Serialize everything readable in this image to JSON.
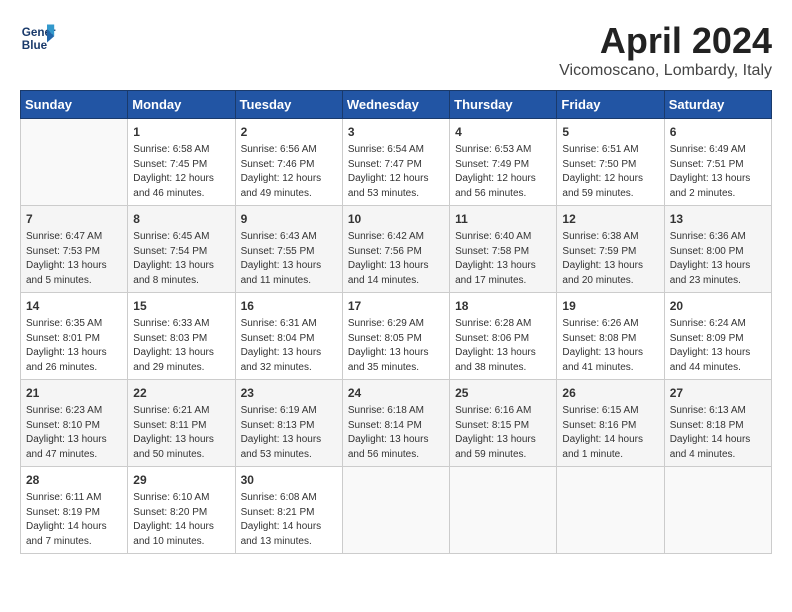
{
  "header": {
    "logo_line1": "General",
    "logo_line2": "Blue",
    "month_title": "April 2024",
    "location": "Vicomoscano, Lombardy, Italy"
  },
  "calendar": {
    "days_of_week": [
      "Sunday",
      "Monday",
      "Tuesday",
      "Wednesday",
      "Thursday",
      "Friday",
      "Saturday"
    ],
    "weeks": [
      [
        {
          "day": "",
          "info": ""
        },
        {
          "day": "1",
          "info": "Sunrise: 6:58 AM\nSunset: 7:45 PM\nDaylight: 12 hours\nand 46 minutes."
        },
        {
          "day": "2",
          "info": "Sunrise: 6:56 AM\nSunset: 7:46 PM\nDaylight: 12 hours\nand 49 minutes."
        },
        {
          "day": "3",
          "info": "Sunrise: 6:54 AM\nSunset: 7:47 PM\nDaylight: 12 hours\nand 53 minutes."
        },
        {
          "day": "4",
          "info": "Sunrise: 6:53 AM\nSunset: 7:49 PM\nDaylight: 12 hours\nand 56 minutes."
        },
        {
          "day": "5",
          "info": "Sunrise: 6:51 AM\nSunset: 7:50 PM\nDaylight: 12 hours\nand 59 minutes."
        },
        {
          "day": "6",
          "info": "Sunrise: 6:49 AM\nSunset: 7:51 PM\nDaylight: 13 hours\nand 2 minutes."
        }
      ],
      [
        {
          "day": "7",
          "info": "Sunrise: 6:47 AM\nSunset: 7:53 PM\nDaylight: 13 hours\nand 5 minutes."
        },
        {
          "day": "8",
          "info": "Sunrise: 6:45 AM\nSunset: 7:54 PM\nDaylight: 13 hours\nand 8 minutes."
        },
        {
          "day": "9",
          "info": "Sunrise: 6:43 AM\nSunset: 7:55 PM\nDaylight: 13 hours\nand 11 minutes."
        },
        {
          "day": "10",
          "info": "Sunrise: 6:42 AM\nSunset: 7:56 PM\nDaylight: 13 hours\nand 14 minutes."
        },
        {
          "day": "11",
          "info": "Sunrise: 6:40 AM\nSunset: 7:58 PM\nDaylight: 13 hours\nand 17 minutes."
        },
        {
          "day": "12",
          "info": "Sunrise: 6:38 AM\nSunset: 7:59 PM\nDaylight: 13 hours\nand 20 minutes."
        },
        {
          "day": "13",
          "info": "Sunrise: 6:36 AM\nSunset: 8:00 PM\nDaylight: 13 hours\nand 23 minutes."
        }
      ],
      [
        {
          "day": "14",
          "info": "Sunrise: 6:35 AM\nSunset: 8:01 PM\nDaylight: 13 hours\nand 26 minutes."
        },
        {
          "day": "15",
          "info": "Sunrise: 6:33 AM\nSunset: 8:03 PM\nDaylight: 13 hours\nand 29 minutes."
        },
        {
          "day": "16",
          "info": "Sunrise: 6:31 AM\nSunset: 8:04 PM\nDaylight: 13 hours\nand 32 minutes."
        },
        {
          "day": "17",
          "info": "Sunrise: 6:29 AM\nSunset: 8:05 PM\nDaylight: 13 hours\nand 35 minutes."
        },
        {
          "day": "18",
          "info": "Sunrise: 6:28 AM\nSunset: 8:06 PM\nDaylight: 13 hours\nand 38 minutes."
        },
        {
          "day": "19",
          "info": "Sunrise: 6:26 AM\nSunset: 8:08 PM\nDaylight: 13 hours\nand 41 minutes."
        },
        {
          "day": "20",
          "info": "Sunrise: 6:24 AM\nSunset: 8:09 PM\nDaylight: 13 hours\nand 44 minutes."
        }
      ],
      [
        {
          "day": "21",
          "info": "Sunrise: 6:23 AM\nSunset: 8:10 PM\nDaylight: 13 hours\nand 47 minutes."
        },
        {
          "day": "22",
          "info": "Sunrise: 6:21 AM\nSunset: 8:11 PM\nDaylight: 13 hours\nand 50 minutes."
        },
        {
          "day": "23",
          "info": "Sunrise: 6:19 AM\nSunset: 8:13 PM\nDaylight: 13 hours\nand 53 minutes."
        },
        {
          "day": "24",
          "info": "Sunrise: 6:18 AM\nSunset: 8:14 PM\nDaylight: 13 hours\nand 56 minutes."
        },
        {
          "day": "25",
          "info": "Sunrise: 6:16 AM\nSunset: 8:15 PM\nDaylight: 13 hours\nand 59 minutes."
        },
        {
          "day": "26",
          "info": "Sunrise: 6:15 AM\nSunset: 8:16 PM\nDaylight: 14 hours\nand 1 minute."
        },
        {
          "day": "27",
          "info": "Sunrise: 6:13 AM\nSunset: 8:18 PM\nDaylight: 14 hours\nand 4 minutes."
        }
      ],
      [
        {
          "day": "28",
          "info": "Sunrise: 6:11 AM\nSunset: 8:19 PM\nDaylight: 14 hours\nand 7 minutes."
        },
        {
          "day": "29",
          "info": "Sunrise: 6:10 AM\nSunset: 8:20 PM\nDaylight: 14 hours\nand 10 minutes."
        },
        {
          "day": "30",
          "info": "Sunrise: 6:08 AM\nSunset: 8:21 PM\nDaylight: 14 hours\nand 13 minutes."
        },
        {
          "day": "",
          "info": ""
        },
        {
          "day": "",
          "info": ""
        },
        {
          "day": "",
          "info": ""
        },
        {
          "day": "",
          "info": ""
        }
      ]
    ]
  }
}
